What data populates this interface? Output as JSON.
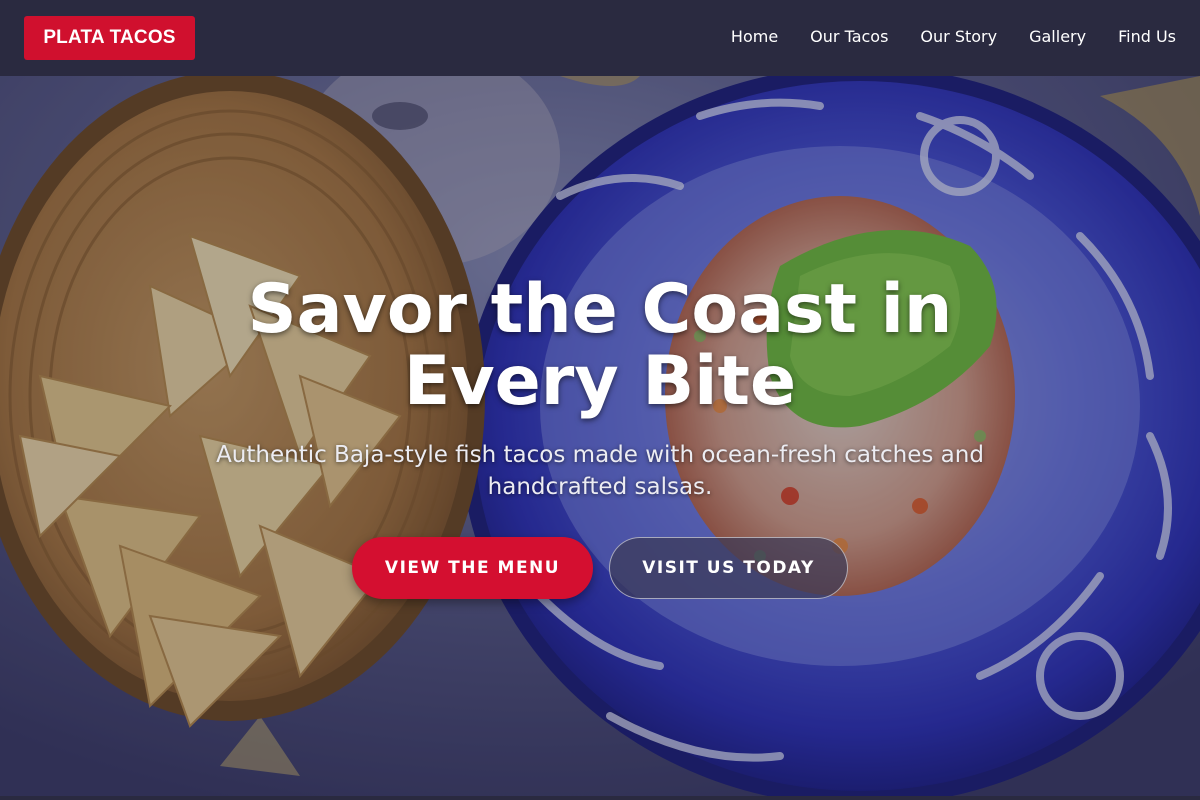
{
  "brand": {
    "logo_text": "PLATA TACOS",
    "accent_color": "#d0102e",
    "nav_background": "#2a2a40"
  },
  "nav": {
    "items": [
      {
        "label": "Home"
      },
      {
        "label": "Our Tacos"
      },
      {
        "label": "Our Story"
      },
      {
        "label": "Gallery"
      },
      {
        "label": "Find Us"
      }
    ]
  },
  "hero": {
    "background_image": "basket of tortilla chips beside a blue painted plate of ceviche topped with avocado",
    "title": "Savor the Coast in Every Bite",
    "subtitle": "Authentic Baja-style fish tacos made with ocean-fresh catches and handcrafted salsas.",
    "primary_button": "VIEW THE MENU",
    "secondary_button": "VISIT US TODAY"
  }
}
